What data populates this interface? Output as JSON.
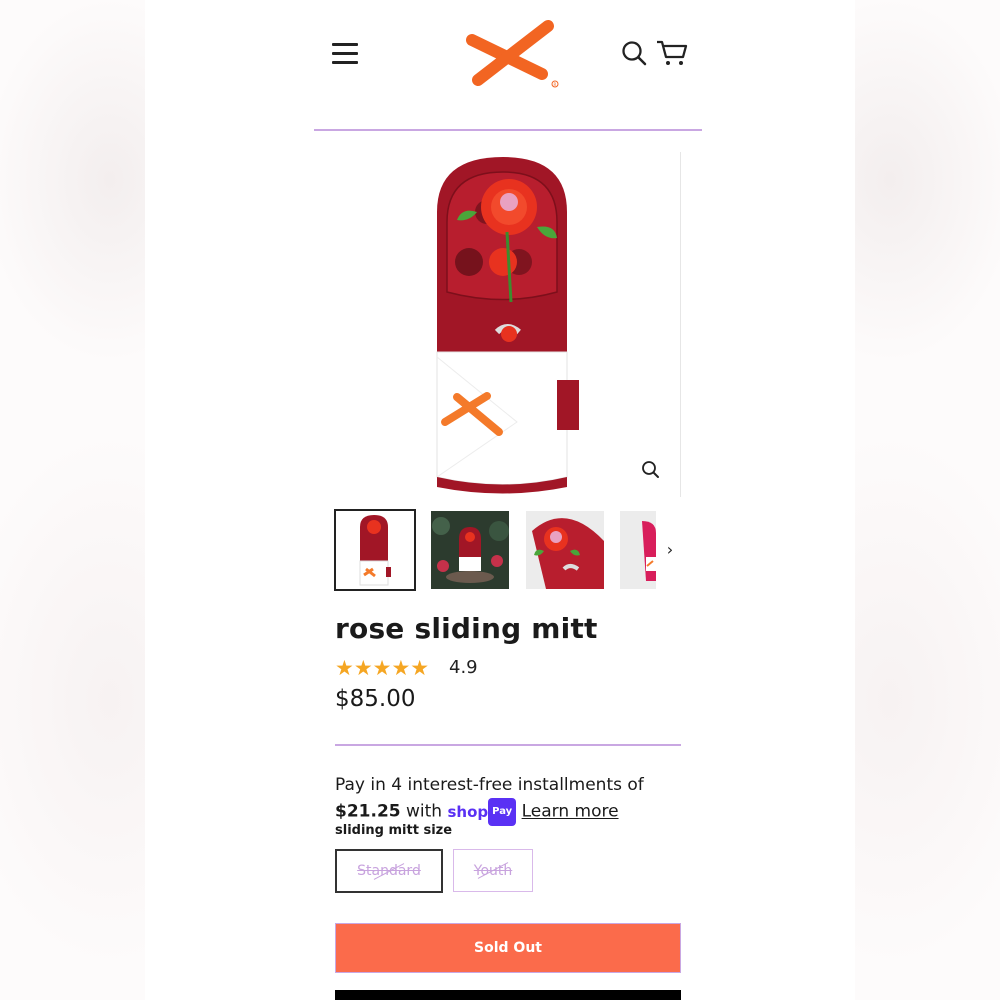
{
  "header": {
    "menu_icon": "hamburger-menu-icon",
    "logo_icon": "brand-x-logo",
    "search_icon": "search-icon",
    "cart_icon": "cart-icon",
    "brand_color": "#f26522"
  },
  "gallery": {
    "zoom_icon": "zoom-icon",
    "thumbnails": [
      {
        "icon": "rose-mitt-front-thumbnail",
        "active": true
      },
      {
        "icon": "rose-mitt-scene-thumbnail",
        "active": false
      },
      {
        "icon": "rose-mitt-detail-thumbnail",
        "active": false
      },
      {
        "icon": "rose-mitt-side-thumbnail",
        "active": false
      }
    ],
    "next_icon": "chevron-right-icon"
  },
  "product": {
    "title": "rose sliding mitt",
    "stars": "★★★★★",
    "rating": "4.9",
    "price": "$85.00"
  },
  "installments": {
    "line1": "Pay in 4 interest-free installments of",
    "amount": "$21.25",
    "with": "with",
    "shop_word": "shop",
    "pay_badge": "Pay",
    "learn_more": "Learn more"
  },
  "size": {
    "label": "sliding mitt size",
    "options": [
      {
        "label": "Standard",
        "selected": true,
        "available": false
      },
      {
        "label": "Youth",
        "selected": false,
        "available": false
      }
    ]
  },
  "buttons": {
    "sold_out": "Sold Out",
    "sold_out_color": "#fb6b4b",
    "accent_line_color": "#c9a7e2"
  }
}
